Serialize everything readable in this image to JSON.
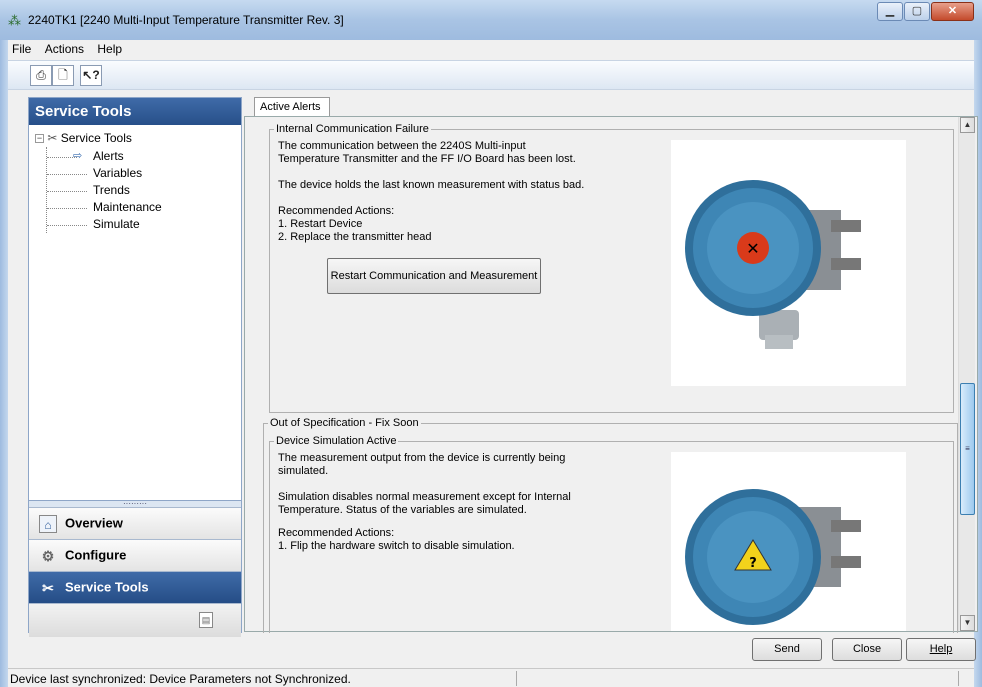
{
  "window": {
    "title": "2240TK1 [2240 Multi-Input Temperature Transmitter Rev. 3]",
    "app_icon": "network-nodes-icon",
    "controls": [
      "minimize",
      "maximize",
      "close"
    ]
  },
  "menu": {
    "items": [
      {
        "label": "File"
      },
      {
        "label": "Actions"
      },
      {
        "label": "Help"
      }
    ]
  },
  "toolbar": {
    "buttons": [
      {
        "icon": "print-icon"
      },
      {
        "icon": "print-preview-icon"
      },
      {
        "icon": "whats-this-help-icon"
      }
    ]
  },
  "sidebar": {
    "header": "Service Tools",
    "tree": {
      "root_label": "Service Tools",
      "items": [
        {
          "label": "Alerts",
          "selected": true
        },
        {
          "label": "Variables"
        },
        {
          "label": "Trends"
        },
        {
          "label": "Maintenance"
        },
        {
          "label": "Simulate"
        }
      ]
    },
    "splitter_grip": "·········",
    "nav": [
      {
        "label": "Overview",
        "icon": "home-icon"
      },
      {
        "label": "Configure",
        "icon": "gear-icon"
      },
      {
        "label": "Service Tools",
        "icon": "tools-icon",
        "active": true
      }
    ]
  },
  "tabs": [
    {
      "label": "Active Alerts",
      "active": true
    }
  ],
  "alerts": {
    "group1": {
      "title": "Internal Communication Failure",
      "text1": "The communication between the 2240S Multi-input Temperature Transmitter and the FF I/O Board has been lost.",
      "text2": "The device holds the last known measurement with status bad.",
      "actions_heading": "Recommended Actions:",
      "action1": "1. Restart Device",
      "action2": "2. Replace the transmitter head",
      "button": "Restart Communication and Measurement",
      "image_badge": "error-x-icon"
    },
    "group2": {
      "category": "Out of Specification - Fix Soon",
      "title": "Device Simulation Active",
      "text1": "The measurement output from the device is currently being simulated.",
      "text2": "Simulation disables normal measurement except for Internal Temperature. Status of the variables are simulated.",
      "actions_heading": "Recommended Actions:",
      "action1": "1. Flip the hardware switch to disable simulation.",
      "image_badge": "warning-question-icon"
    }
  },
  "buttons": {
    "send": "Send",
    "close": "Close",
    "help": "Help"
  },
  "status": {
    "text": "Device last synchronized: Device Parameters not Synchronized."
  },
  "colors": {
    "accent": "#2e5c9b",
    "device_body": "#3e86b5",
    "error": "#d93a1a",
    "warning": "#f2d21b"
  }
}
